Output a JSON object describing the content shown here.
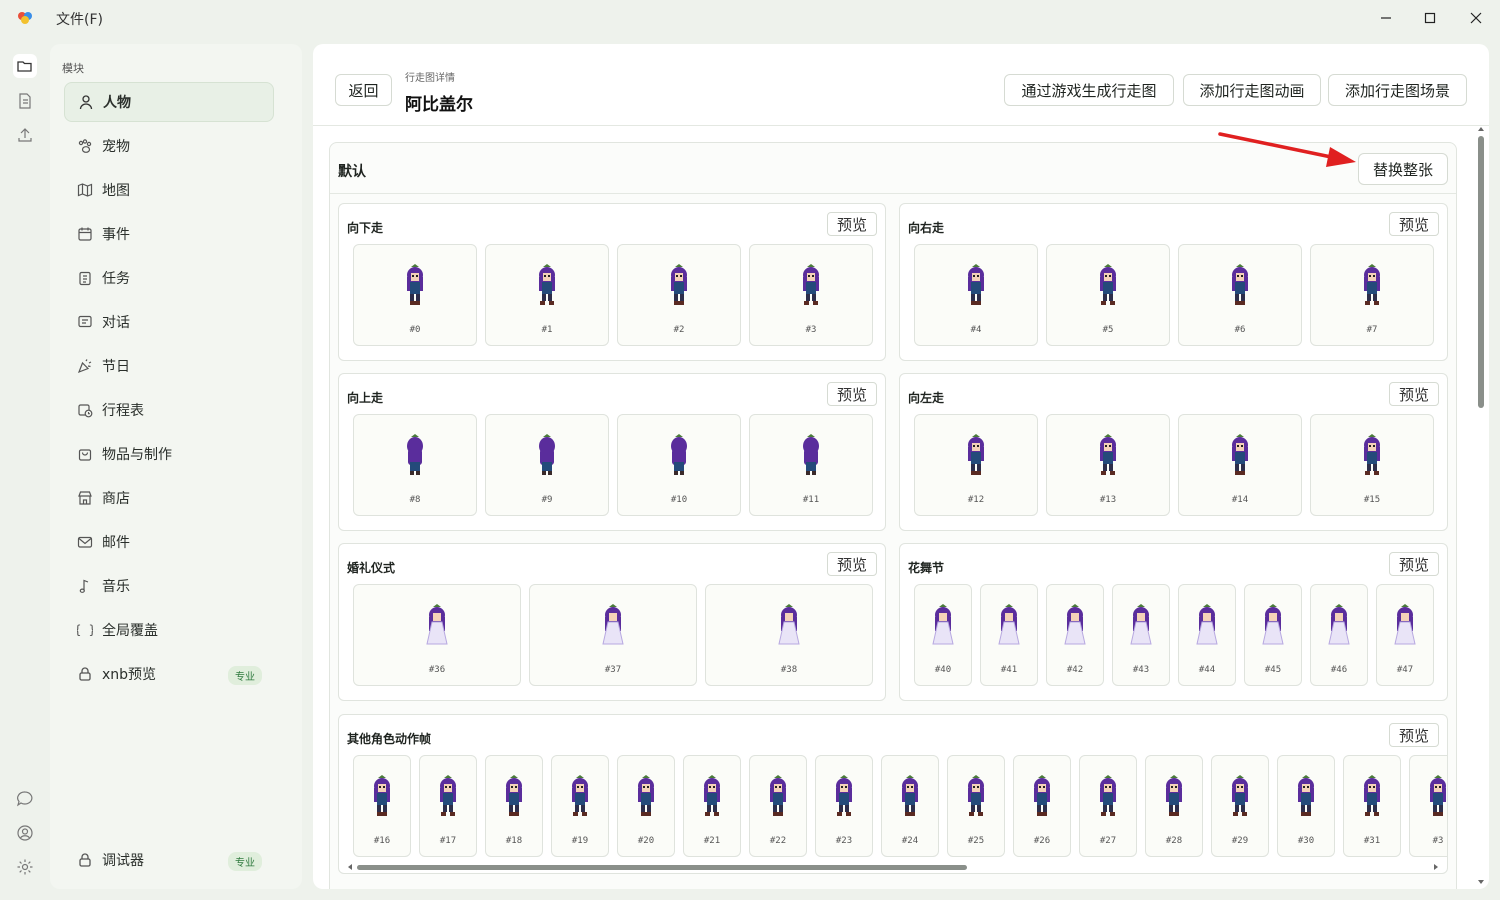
{
  "titlebar": {
    "menu_file": "文件(F)"
  },
  "sidebar": {
    "header": "模块",
    "items": [
      {
        "label": "人物",
        "icon": "user-icon",
        "active": true
      },
      {
        "label": "宠物",
        "icon": "paw-icon"
      },
      {
        "label": "地图",
        "icon": "map-icon"
      },
      {
        "label": "事件",
        "icon": "calendar-icon"
      },
      {
        "label": "任务",
        "icon": "clipboard-icon"
      },
      {
        "label": "对话",
        "icon": "chat-icon"
      },
      {
        "label": "节日",
        "icon": "party-icon"
      },
      {
        "label": "行程表",
        "icon": "schedule-icon"
      },
      {
        "label": "物品与制作",
        "icon": "bag-icon"
      },
      {
        "label": "商店",
        "icon": "store-icon"
      },
      {
        "label": "邮件",
        "icon": "mail-icon"
      },
      {
        "label": "音乐",
        "icon": "music-icon"
      },
      {
        "label": "全局覆盖",
        "icon": "braces-icon"
      },
      {
        "label": "xnb预览",
        "icon": "lock-icon",
        "badge": "专业"
      }
    ],
    "bottom_item": {
      "label": "调试器",
      "icon": "lock-icon",
      "badge": "专业"
    }
  },
  "header": {
    "back": "返回",
    "breadcrumb": "行走图详情",
    "title": "阿比盖尔",
    "actions": [
      "通过游戏生成行走图",
      "添加行走图动画",
      "添加行走图场景"
    ]
  },
  "panel": {
    "title": "默认",
    "replace_button": "替换整张",
    "preview_label": "预览",
    "sections": [
      {
        "title": "向下走",
        "frames": [
          "#0",
          "#1",
          "#2",
          "#3"
        ],
        "kind": "walk"
      },
      {
        "title": "向右走",
        "frames": [
          "#4",
          "#5",
          "#6",
          "#7"
        ],
        "kind": "walk"
      },
      {
        "title": "向上走",
        "frames": [
          "#8",
          "#9",
          "#10",
          "#11"
        ],
        "kind": "back"
      },
      {
        "title": "向左走",
        "frames": [
          "#12",
          "#13",
          "#14",
          "#15"
        ],
        "kind": "walk"
      },
      {
        "title": "婚礼仪式",
        "frames": [
          "#36",
          "#37",
          "#38"
        ],
        "kind": "dress"
      },
      {
        "title": "花舞节",
        "frames": [
          "#40",
          "#41",
          "#42",
          "#43",
          "#44",
          "#45",
          "#46",
          "#47"
        ],
        "kind": "dress"
      },
      {
        "title": "其他角色动作帧",
        "frames": [
          "#16",
          "#17",
          "#18",
          "#19",
          "#20",
          "#21",
          "#22",
          "#23",
          "#24",
          "#25",
          "#26",
          "#27",
          "#28",
          "#29",
          "#30",
          "#31",
          "#3"
        ],
        "kind": "walk"
      }
    ]
  },
  "colors": {
    "accent_arrow": "#e02020",
    "hair": "#5a2d9c",
    "outfit": "#244a7a",
    "dress": "#e9e4f7"
  }
}
